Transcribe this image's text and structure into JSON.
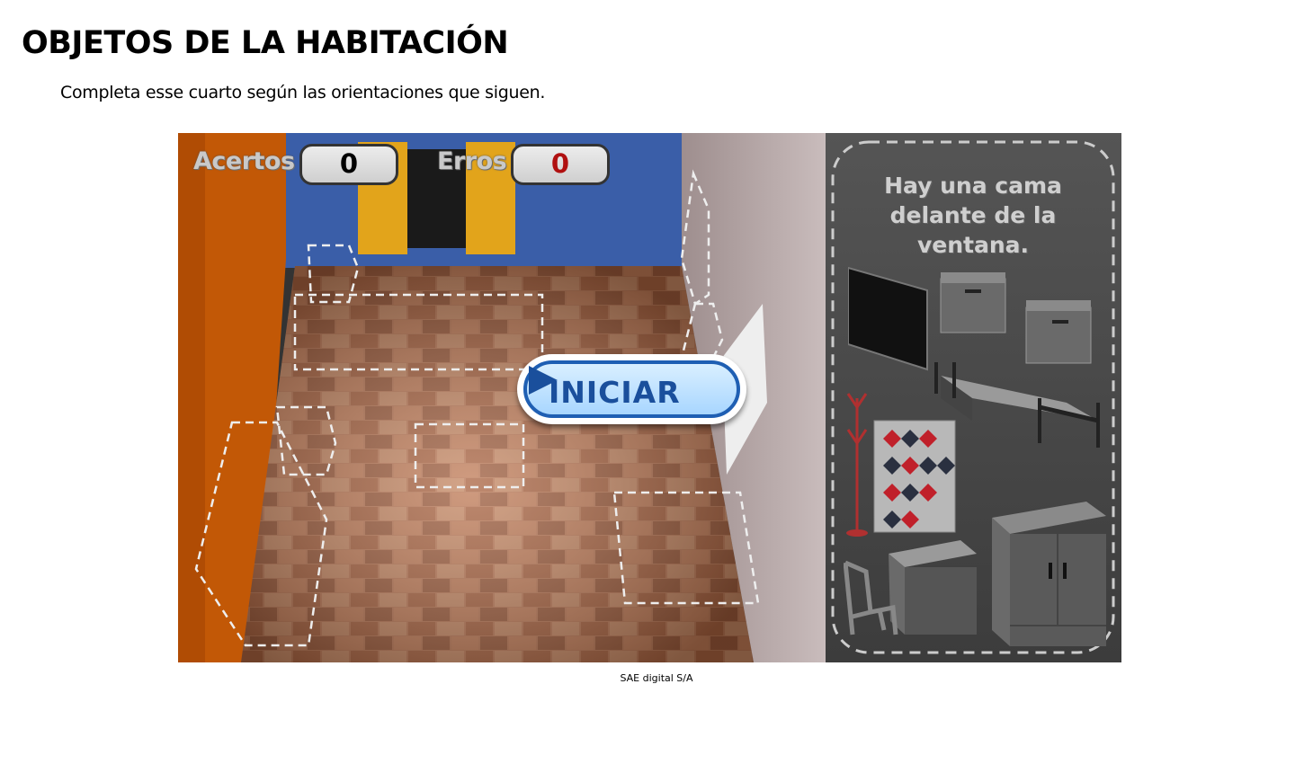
{
  "page": {
    "title": "OBJETOS DE LA HABITACIÓN",
    "instructions": "Completa esse cuarto según las orientaciones que siguen.",
    "credit": "SAE digital S/A"
  },
  "game": {
    "hits_label": "Acertos",
    "hits_value": "0",
    "errors_label": "Erros",
    "errors_value": "0",
    "start_label": "INICIAR",
    "hint": "Hay una cama delante de la ventana.",
    "colors": {
      "wall_blue": "#3a5ea8",
      "wall_orange": "#c85a0a",
      "floor": "#b8734a",
      "panel": "#4a4a4a",
      "button_blue": "#1f5fb3",
      "error_red": "#b01010"
    },
    "objects": [
      "tv-icon",
      "nightstand-icon",
      "nightstand-icon",
      "bed-icon",
      "coat-rack-icon",
      "rug-icon",
      "desk-chair-icon",
      "wardrobe-icon"
    ]
  }
}
